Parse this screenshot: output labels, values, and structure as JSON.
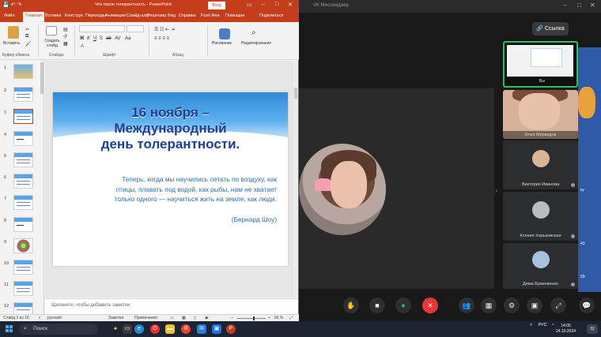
{
  "vk": {
    "title": "VK Мессенджер",
    "link_label": "Ссылка",
    "participants": [
      {
        "name": "Вы"
      },
      {
        "name": "Илья Меркидов"
      },
      {
        "name": "Виктория Иванова"
      },
      {
        "name": "Ксения Харьковская"
      },
      {
        "name": "Дима Браковенко"
      }
    ],
    "side_texts": [
      "ку",
      "43",
      "59"
    ],
    "participants_badge": "5",
    "colors": {
      "end_call": "#e8373b",
      "active_tile": "#2dbf61"
    }
  },
  "ppt": {
    "title": "Что такое толерантность - PowerPoint",
    "login_label": "Вход",
    "tabs": [
      "Файл",
      "Главная",
      "Вставка",
      "Конструк",
      "Переходы",
      "Анимация",
      "Слайд-шоу",
      "Рецензир",
      "Вид",
      "Справка",
      "Foxit Rea",
      "Помощни",
      "Поделиться"
    ],
    "ribbon": {
      "paste": "Вставить",
      "create_slide": "Создать слайд",
      "drawing": "Рисование",
      "editing": "Редактирование",
      "groups": [
        "Буфер обмена",
        "Слайды",
        "Шрифт",
        "Абзац"
      ],
      "format": [
        "Ж",
        "К",
        "Ч",
        "S",
        "ab",
        "AV",
        "Aa"
      ]
    },
    "slide_numbers": [
      "1",
      "2",
      "3",
      "4",
      "5",
      "6",
      "7",
      "8",
      "9",
      "10",
      "11",
      "12"
    ],
    "selected_slide": "3",
    "slide": {
      "title_line1": "16 ноября –",
      "title_line2": "Международный",
      "title_line3": "день толерантности.",
      "body_line1": "Теперь, когда мы научились летать по воздуху, как",
      "body_line2": "птицы, плавать под водой, как рыбы, нам не хватает",
      "body_line3": "только одного — научиться жить на земле, как люди.",
      "quote": "(Бернард Шоу)"
    },
    "notes_placeholder": "Щелкните, чтобы добавить заметки",
    "status": {
      "slide_counter": "Слайд 3 из 18",
      "language": "русский",
      "notes": "Заметки",
      "comments": "Примечания",
      "zoom": "66 %"
    }
  },
  "taskbar": {
    "search_label": "Поиск",
    "language": "РУС",
    "time": "14:05",
    "date": "24.10.2024",
    "notifications": "32"
  }
}
